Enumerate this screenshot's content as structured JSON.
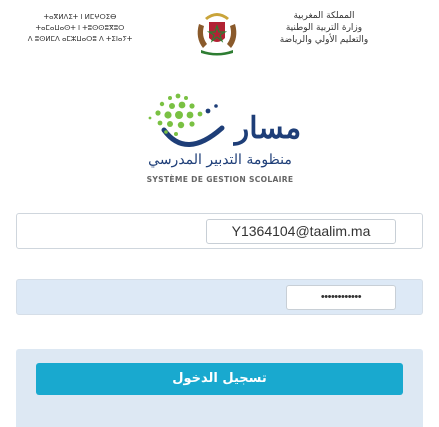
{
  "header": {
    "left_lines": [
      "ⵜⴰⴳⵍⴷⵉⵜ ⵏ ⵍⵎⵖⵔⵉⴱ",
      "ⵜⴰⵎⴰⵡⴰⵙⵜ ⵏ ⵜⵓⵙⵙⵓⴳⵓⵔ",
      "ⴷ ⵓⵙⵍⵎⴷ ⴰⵎⵣⵡⴰⵔⵓ ⴷ ⵜⵉⵏⴰⵢⵜ"
    ],
    "right_lines": [
      "المملكة المغربية",
      "وزارة التربية الوطنية",
      "والتعليم الأولي والرياضة"
    ]
  },
  "logo": {
    "mark_text": "مسار",
    "arabic_name": "منظومة التدبير المدرسي",
    "french_name": "SYSTÈME DE GESTION SCOLAIRE"
  },
  "form": {
    "username_value": "Y1364104@taalim.ma",
    "password_value": "••••••••••••",
    "submit_label": "تسجيل الدخول"
  },
  "colors": {
    "primary": "#19a9cf",
    "brand_navy": "#1e3e78",
    "brand_green": "#7ac143",
    "panel_bg": "#dde8f3"
  }
}
